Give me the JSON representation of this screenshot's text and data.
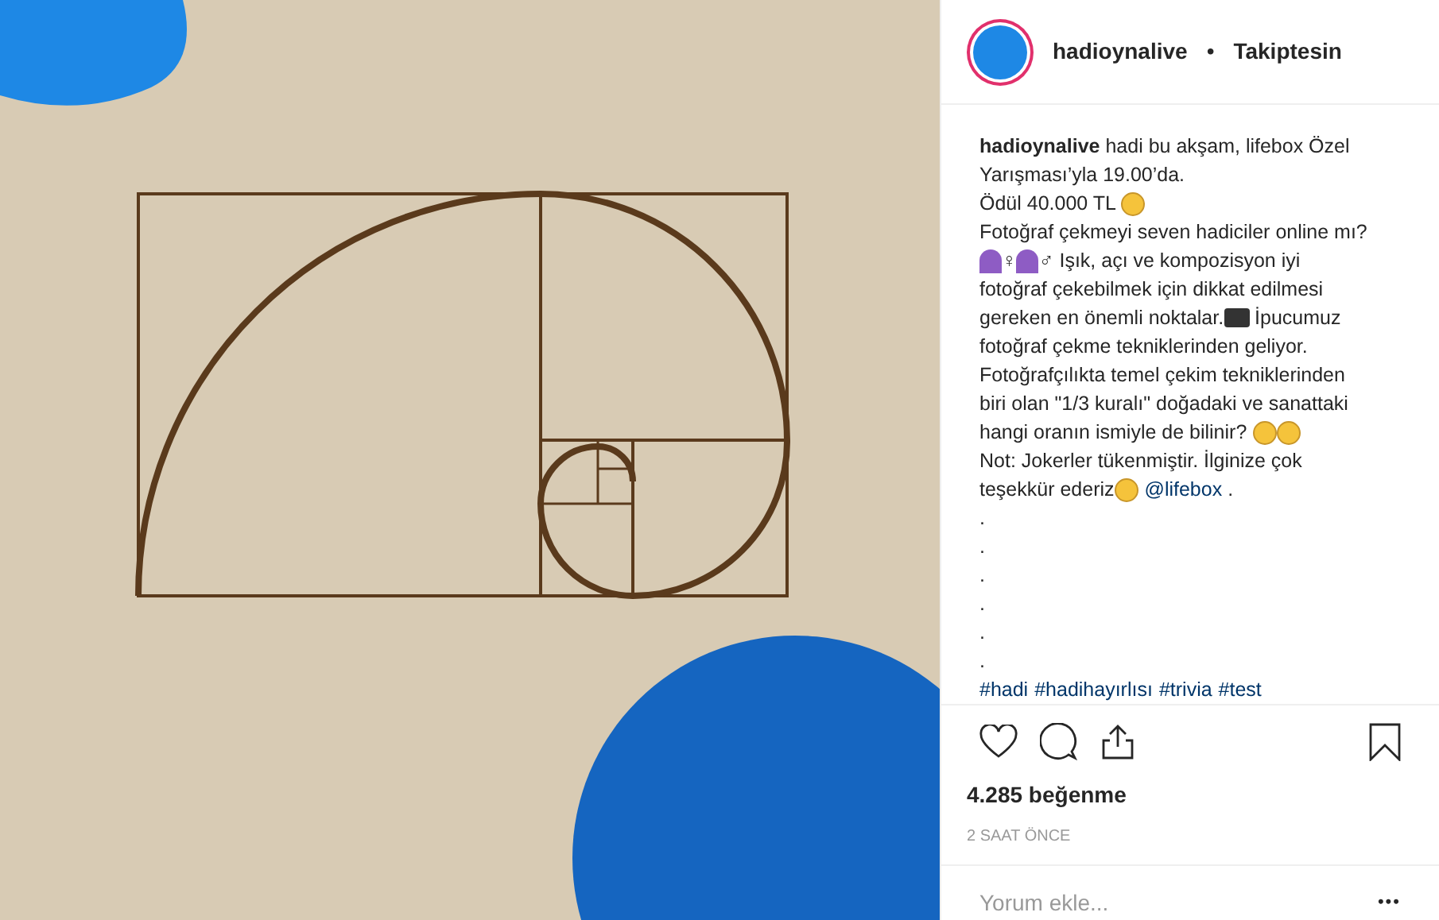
{
  "header": {
    "username": "hadioynalive",
    "separator": "•",
    "follow_state": "Takiptesin"
  },
  "caption": [
    [
      {
        "kind": "user",
        "text": "hadioynalive"
      },
      {
        "kind": "text",
        "text": " hadi bu akşam, lifebox Özel"
      }
    ],
    [
      {
        "kind": "text",
        "text": "Yarışması’yla 19.00’da."
      }
    ],
    [
      {
        "kind": "text",
        "text": "Ödül 40.000 TL "
      },
      {
        "kind": "emoji"
      }
    ],
    [
      {
        "kind": "text",
        "text": "Fotoğraf çekmeyi seven hadiciler online mı?"
      }
    ],
    [
      {
        "kind": "person"
      },
      {
        "kind": "text",
        "text": "♀"
      },
      {
        "kind": "person"
      },
      {
        "kind": "text",
        "text": "♂ Işık, açı ve kompozisyon iyi"
      }
    ],
    [
      {
        "kind": "text",
        "text": "fotoğraf çekebilmek için dikkat edilmesi"
      }
    ],
    [
      {
        "kind": "text",
        "text": "gereken en önemli noktalar."
      },
      {
        "kind": "camera"
      },
      {
        "kind": "text",
        "text": " İpucumuz"
      }
    ],
    [
      {
        "kind": "text",
        "text": "fotoğraf çekme tekniklerinden geliyor."
      }
    ],
    [
      {
        "kind": "text",
        "text": "Fotoğrafçılıkta temel çekim tekniklerinden"
      }
    ],
    [
      {
        "kind": "text",
        "text": "biri olan \"1/3 kuralı\" doğadaki ve sanattaki"
      }
    ],
    [
      {
        "kind": "text",
        "text": "hangi oranın ismiyle de bilinir? "
      },
      {
        "kind": "emoji"
      },
      {
        "kind": "emoji"
      }
    ],
    [
      {
        "kind": "text",
        "text": "Not: Jokerler tükenmiştir. İlginize çok"
      }
    ],
    [
      {
        "kind": "text",
        "text": "teşekkür ederiz"
      },
      {
        "kind": "emoji"
      },
      {
        "kind": "link",
        "text": "@lifebox"
      },
      {
        "kind": "text",
        "text": " ."
      }
    ],
    [
      {
        "kind": "text",
        "text": "."
      }
    ],
    [
      {
        "kind": "text",
        "text": "."
      }
    ],
    [
      {
        "kind": "text",
        "text": "."
      }
    ],
    [
      {
        "kind": "text",
        "text": "."
      }
    ],
    [
      {
        "kind": "text",
        "text": "."
      }
    ],
    [
      {
        "kind": "text",
        "text": "."
      }
    ],
    [
      {
        "kind": "link",
        "text": "#hadi"
      },
      {
        "kind": "link",
        "text": "#hadihayırlısı"
      },
      {
        "kind": "link",
        "text": "#trivia"
      },
      {
        "kind": "link",
        "text": "#test"
      }
    ]
  ],
  "likes": "4.285 beğenme",
  "time": "2 SAAT ÖNCE",
  "comment": {
    "placeholder": "Yorum ekle...",
    "more": "•••"
  }
}
